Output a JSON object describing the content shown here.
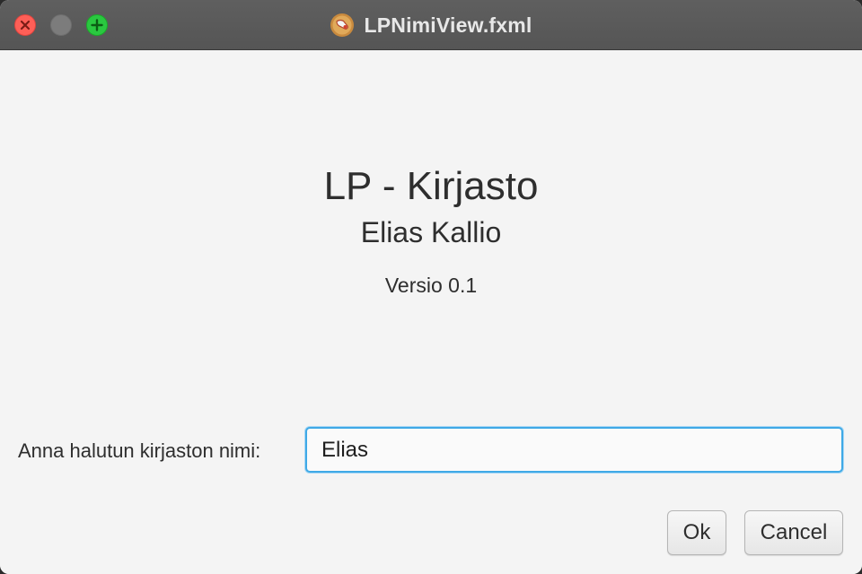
{
  "window": {
    "title": "LPNimiView.fxml",
    "app_icon": "duke-java-icon",
    "controls": [
      "close-icon",
      "minimize-icon",
      "zoom-icon"
    ]
  },
  "main": {
    "heading": "LP - Kirjasto",
    "author": "Elias Kallio",
    "version": "Versio 0.1"
  },
  "form": {
    "label": "Anna halutun kirjaston nimi:",
    "input_value": "Elias"
  },
  "buttons": {
    "ok": "Ok",
    "cancel": "Cancel"
  },
  "colors": {
    "titlebar": "#5a5a5a",
    "background": "#f4f4f4",
    "focus_ring": "#3fa9e6",
    "close": "#fe5f57",
    "zoom": "#2ac840"
  }
}
